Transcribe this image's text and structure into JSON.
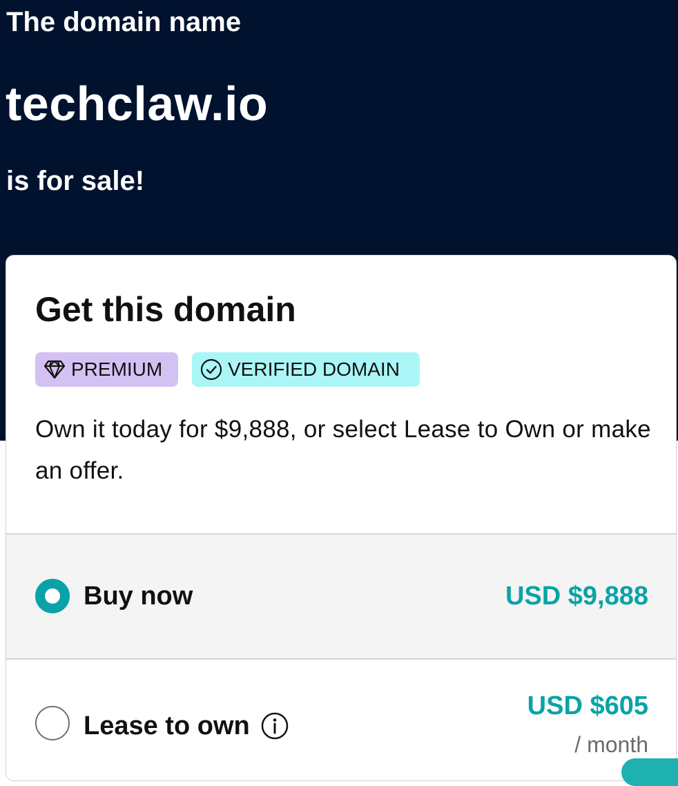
{
  "hero": {
    "pre_text": "The domain name",
    "domain": "techclaw.io",
    "post_text": "is for sale!"
  },
  "card": {
    "title": "Get this domain",
    "badges": {
      "premium": {
        "label": "PREMIUM",
        "icon": "diamond-icon",
        "color": "#d4c1f4"
      },
      "verified": {
        "label": "VERIFIED DOMAIN",
        "icon": "check-circle-icon",
        "color": "#aaf6f6"
      }
    },
    "description": "Own it today for $9,888, or select Lease to Own or make an offer.",
    "options": {
      "buy": {
        "label": "Buy now",
        "price": "USD $9,888",
        "selected": true
      },
      "lease": {
        "label": "Lease to own",
        "price": "USD $605",
        "period": "/ month",
        "selected": false,
        "info_icon": "info-icon"
      }
    }
  },
  "colors": {
    "hero_bg": "#00122e",
    "accent": "#09a3a7"
  }
}
